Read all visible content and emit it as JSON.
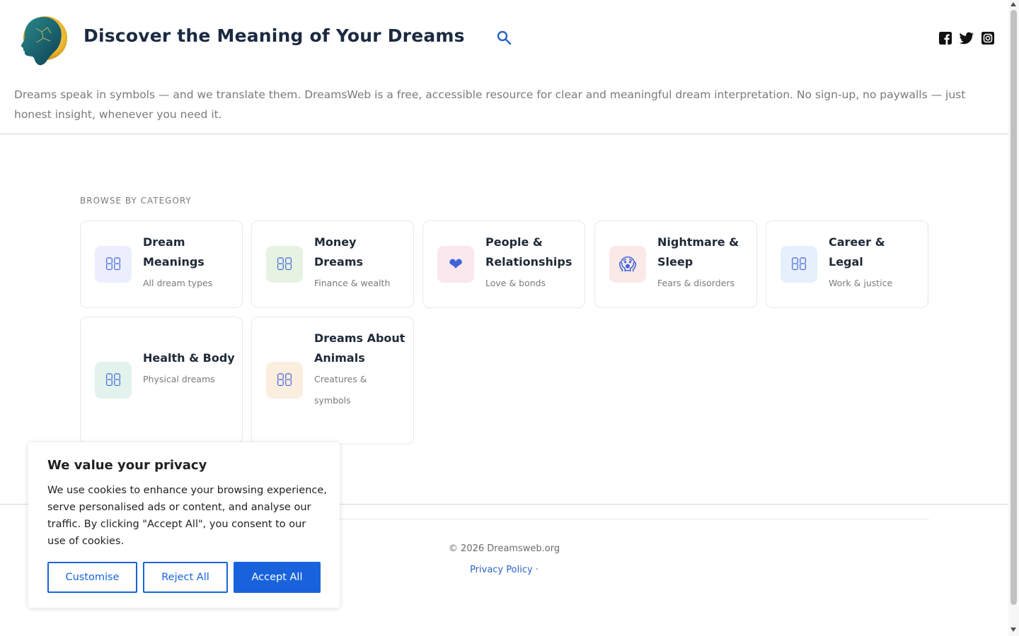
{
  "header": {
    "site_title": "Discover the Meaning of Your Dreams",
    "logo_icon": "dream-head-logo",
    "search_icon": "search-icon",
    "social": [
      "facebook-icon",
      "twitter-icon",
      "instagram-icon"
    ]
  },
  "intro": "Dreams speak in symbols — and we translate them. DreamsWeb is a free, accessible resource for clear and meaningful dream interpretation. No sign-up, no paywalls — just honest insight, whenever you need it.",
  "browse": {
    "label": "BROWSE BY CATEGORY",
    "categories": [
      {
        "title": "Dream Meanings",
        "sub": "All dream types",
        "icon": "",
        "icon_name": "missing-glyph-icon",
        "bg": "#eceefd"
      },
      {
        "title": "Money Dreams",
        "sub": "Finance & wealth",
        "icon": "",
        "icon_name": "missing-glyph-icon",
        "bg": "#e6f2e2"
      },
      {
        "title": "People & Relationships",
        "sub": "Love & bonds",
        "icon": "❤",
        "icon_name": "heart-icon",
        "bg": "#fbe7ee"
      },
      {
        "title": "Nightmare & Sleep",
        "sub": "Fears & disorders",
        "icon": "😱",
        "icon_name": "scream-face-icon",
        "bg": "#fbe9e8"
      },
      {
        "title": "Career & Legal",
        "sub": "Work & justice",
        "icon": "",
        "icon_name": "missing-glyph-icon",
        "bg": "#e6effc"
      },
      {
        "title": "Health & Body",
        "sub": "Physical dreams",
        "icon": "",
        "icon_name": "missing-glyph-icon",
        "bg": "#e2f3ee"
      },
      {
        "title": "Dreams About Animals",
        "sub": "Creatures & symbols",
        "icon": "",
        "icon_name": "missing-glyph-icon",
        "bg": "#fbeedf"
      }
    ]
  },
  "footer": {
    "copyright": "© 2026 Dreamsweb.org",
    "privacy_link": "Privacy Policy",
    "separator": " ·"
  },
  "cookie": {
    "title": "We value your privacy",
    "body": "We use cookies to enhance your browsing experience, serve personalised ads or content, and analyse our traffic. By clicking \"Accept All\", you consent to our use of cookies.",
    "customise": "Customise",
    "reject": "Reject All",
    "accept": "Accept All"
  },
  "colors": {
    "accent": "#1863dc",
    "title": "#1b2a41",
    "icon": "#3e64d8"
  }
}
